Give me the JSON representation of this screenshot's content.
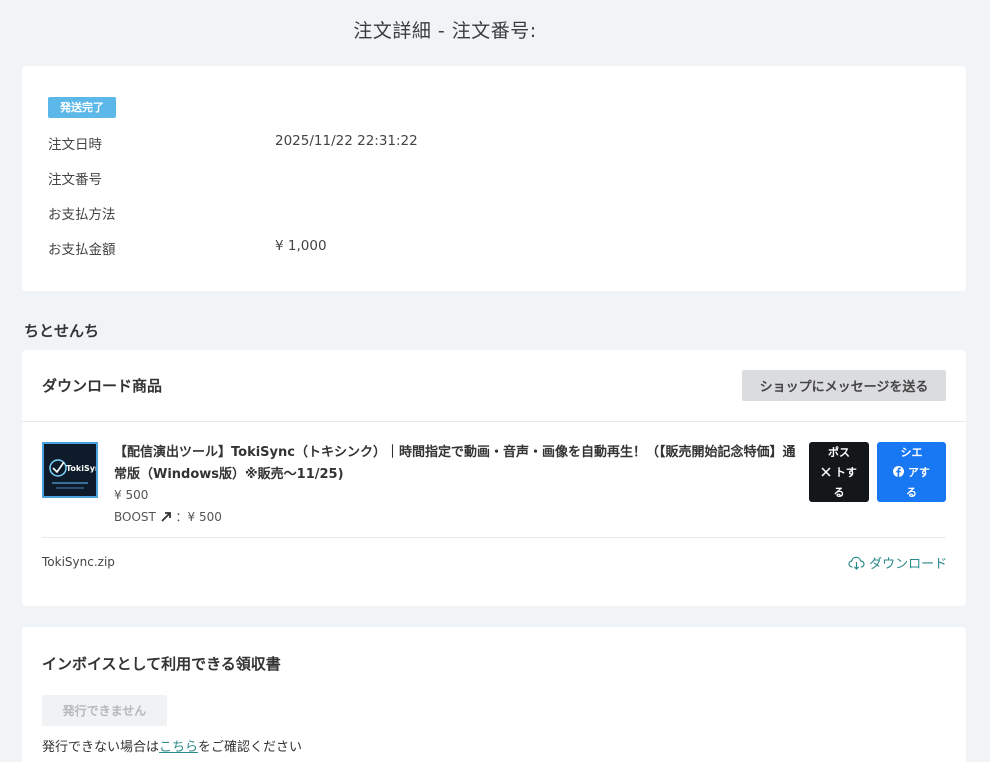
{
  "page": {
    "title": "注文詳細 - 注文番号:"
  },
  "order": {
    "status": "発送完了",
    "rows": [
      {
        "label": "注文日時",
        "value": "2025/11/22 22:31:22"
      },
      {
        "label": "注文番号",
        "value": ""
      },
      {
        "label": "お支払方法",
        "value": ""
      },
      {
        "label": "お支払金額",
        "value": "¥ 1,000"
      }
    ]
  },
  "shop": {
    "name": "ちとせんち"
  },
  "downloads": {
    "heading": "ダウンロード商品",
    "message_button": "ショップにメッセージを送る",
    "product": {
      "thumbnail_text": "TokiSync",
      "title": "【配信演出ツール】TokiSync（トキシンク）｜時間指定で動画・音声・画像を自動再生！（【販売開始記念特価】通常版（Windows版）※販売〜11/25)",
      "price": "¥ 500",
      "boost_label": "BOOST",
      "boost_value": "：¥ 500"
    },
    "share_x": {
      "line1": "ポス",
      "line2": "トす",
      "line3": "る"
    },
    "share_fb": {
      "line1": "シエ",
      "line2": "アす",
      "line3": "る"
    },
    "file_name": "TokiSync.zip",
    "download_label": "ダウンロード"
  },
  "invoice": {
    "heading": "インボイスとして利用できる領収書",
    "issue_button": "発行できません",
    "note_before": "発行できない場合は",
    "note_link": "こちら",
    "note_after": "をご確認ください"
  },
  "colors": {
    "background": "#f1f4f7",
    "badge": "#5bb8e8",
    "x_button": "#14171a",
    "facebook_button": "#1877f2",
    "link": "#2b8a8a"
  }
}
